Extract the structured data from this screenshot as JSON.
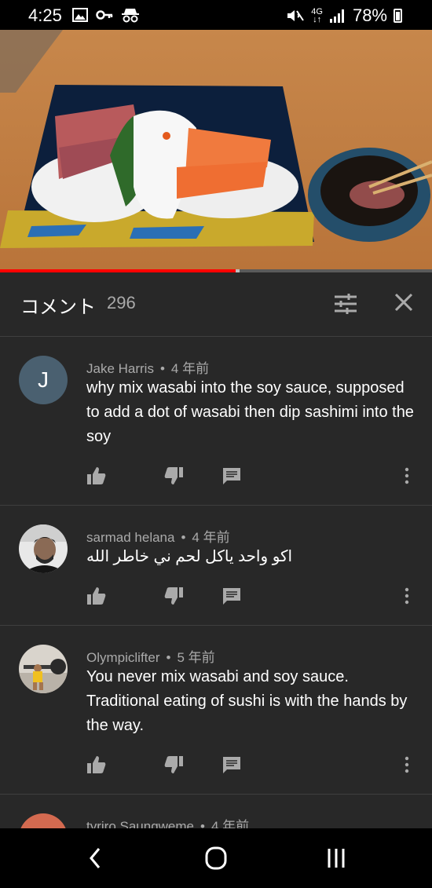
{
  "status_bar": {
    "time": "4:25",
    "network": "4G",
    "battery": "78%",
    "icons": [
      "image-icon",
      "key-icon",
      "incognito-icon",
      "mute-icon",
      "signal-icon",
      "battery-icon"
    ]
  },
  "video": {
    "progress_fraction": 0.545,
    "buffered_fraction": 0.555
  },
  "comments_header": {
    "title": "コメント",
    "count": "296"
  },
  "comments": [
    {
      "avatar_letter": "J",
      "author": "Jake Harris",
      "time": "4 年前",
      "text": "why mix wasabi into the soy sauce, supposed to add a dot of wasabi then dip sashimi into the soy"
    },
    {
      "author": "sarmad helana",
      "time": "4 年前",
      "text": "اكو واحد ياكل لحم ني خاطر الله"
    },
    {
      "author": "Olympiclifter",
      "time": "5 年前",
      "text": "You never mix wasabi and soy sauce. Traditional eating of sushi is with the hands by the way."
    },
    {
      "author": "tyriro Saungweme",
      "time": "4 年前"
    }
  ],
  "meta_separator": "•",
  "colors": {
    "background": "#282828",
    "progress": "#ff0000",
    "secondary_text": "#aaaaaa"
  }
}
